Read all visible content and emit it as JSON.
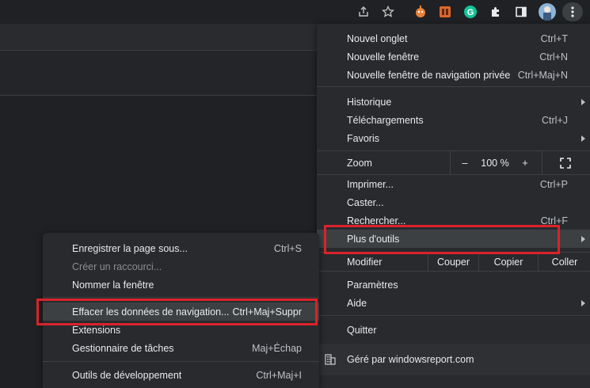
{
  "toolbar": {
    "icons": [
      "share-icon",
      "star-icon",
      "extension-monkey-icon",
      "extension-orange-icon",
      "grammarly-icon",
      "puzzle-icon",
      "sidebar-icon",
      "profile-avatar",
      "kebab-menu-icon"
    ]
  },
  "main_menu": {
    "new_tab": {
      "label": "Nouvel onglet",
      "shortcut": "Ctrl+T"
    },
    "new_window": {
      "label": "Nouvelle fenêtre",
      "shortcut": "Ctrl+N"
    },
    "new_incognito": {
      "label": "Nouvelle fenêtre de navigation privée",
      "shortcut": "Ctrl+Maj+N"
    },
    "history": {
      "label": "Historique"
    },
    "downloads": {
      "label": "Téléchargements",
      "shortcut": "Ctrl+J"
    },
    "bookmarks": {
      "label": "Favoris"
    },
    "zoom": {
      "label": "Zoom",
      "minus": "–",
      "value": "100 %",
      "plus": "+"
    },
    "print": {
      "label": "Imprimer...",
      "shortcut": "Ctrl+P"
    },
    "cast": {
      "label": "Caster..."
    },
    "find": {
      "label": "Rechercher...",
      "shortcut": "Ctrl+F"
    },
    "more_tools": {
      "label": "Plus d'outils"
    },
    "edit": {
      "label": "Modifier",
      "cut": "Couper",
      "copy": "Copier",
      "paste": "Coller"
    },
    "settings": {
      "label": "Paramètres"
    },
    "help": {
      "label": "Aide"
    },
    "exit": {
      "label": "Quitter"
    },
    "managed": {
      "label": "Géré par windowsreport.com"
    }
  },
  "sub_menu": {
    "save_page": {
      "label": "Enregistrer la page sous...",
      "shortcut": "Ctrl+S"
    },
    "create_shortcut": {
      "label": "Créer un raccourci..."
    },
    "name_window": {
      "label": "Nommer la fenêtre"
    },
    "clear_data": {
      "label": "Effacer les données de navigation...",
      "shortcut": "Ctrl+Maj+Suppr"
    },
    "extensions": {
      "label": "Extensions"
    },
    "task_manager": {
      "label": "Gestionnaire de tâches",
      "shortcut": "Maj+Échap"
    },
    "dev_tools": {
      "label": "Outils de développement",
      "shortcut": "Ctrl+Maj+I"
    }
  },
  "colors": {
    "highlight_box": "#d9232c",
    "menu_bg": "#292a2d",
    "page_bg": "#202124"
  }
}
